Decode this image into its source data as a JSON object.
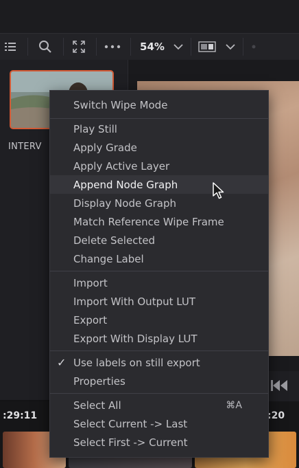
{
  "toolbar": {
    "zoom_label": "54%"
  },
  "gallery": {
    "still_label": "INTERV"
  },
  "timeline": {
    "timecode_left": ":29:11",
    "timecode_right": ":20"
  },
  "context_menu": {
    "groups": [
      [
        {
          "label": "Switch Wipe Mode"
        }
      ],
      [
        {
          "label": "Play Still"
        },
        {
          "label": "Apply Grade"
        },
        {
          "label": "Apply Active Layer"
        },
        {
          "label": "Append Node Graph",
          "highlighted": true
        },
        {
          "label": "Display Node Graph"
        },
        {
          "label": "Match Reference Wipe Frame"
        },
        {
          "label": "Delete Selected"
        },
        {
          "label": "Change Label"
        }
      ],
      [
        {
          "label": "Import"
        },
        {
          "label": "Import With Output LUT"
        },
        {
          "label": "Export"
        },
        {
          "label": "Export With Display LUT"
        }
      ],
      [
        {
          "label": "Use labels on still export",
          "checked": true
        },
        {
          "label": "Properties"
        }
      ],
      [
        {
          "label": "Select All",
          "shortcut": "⌘A"
        },
        {
          "label": "Select Current -> Last"
        },
        {
          "label": "Select First -> Current"
        }
      ]
    ]
  },
  "colors": {
    "accent_selection": "#d35a35",
    "menu_bg": "#2b2b2f",
    "menu_highlight": "#35353a"
  }
}
